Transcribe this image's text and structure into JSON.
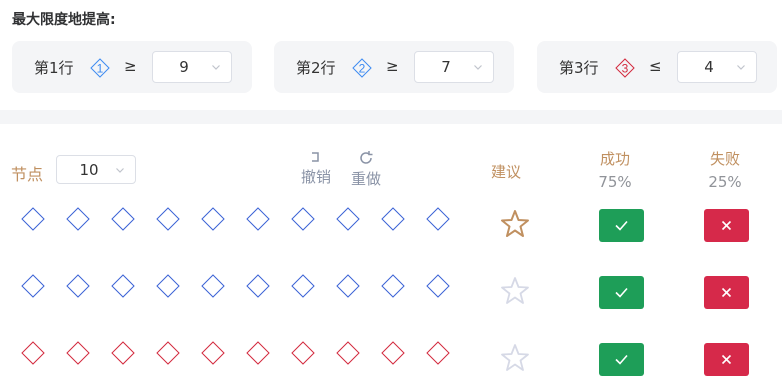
{
  "title": "最大限度地提高:",
  "conditions": [
    {
      "label": "第1行",
      "icon_number": "1",
      "icon_color": "#3d8bf2",
      "op": "≥",
      "value": "9"
    },
    {
      "label": "第2行",
      "icon_number": "2",
      "icon_color": "#3d8bf2",
      "op": "≥",
      "value": "7"
    },
    {
      "label": "第3行",
      "icon_number": "3",
      "icon_color": "#d3293d",
      "op": "≤",
      "value": "4"
    }
  ],
  "node": {
    "label": "节点",
    "value": "10"
  },
  "toolbar": {
    "undo": "撤销",
    "redo": "重做",
    "icon_color": "#8a93a6"
  },
  "columns": {
    "suggest": "建议",
    "success": "成功",
    "success_pct": "75%",
    "fail": "失败",
    "fail_pct": "25%"
  },
  "colors": {
    "blue_diamond": "#3b62d6",
    "red_diamond": "#d3293d",
    "accent": "#c09060",
    "star_active": "#c09060",
    "star_inactive": "#d6d9e6",
    "success": "#1e9e58",
    "fail": "#d6294a"
  },
  "rows": [
    {
      "color": "blue",
      "diamond_count": 10,
      "star": "active"
    },
    {
      "color": "blue",
      "diamond_count": 10,
      "star": "inactive"
    },
    {
      "color": "red",
      "diamond_count": 10,
      "star": "inactive"
    }
  ]
}
